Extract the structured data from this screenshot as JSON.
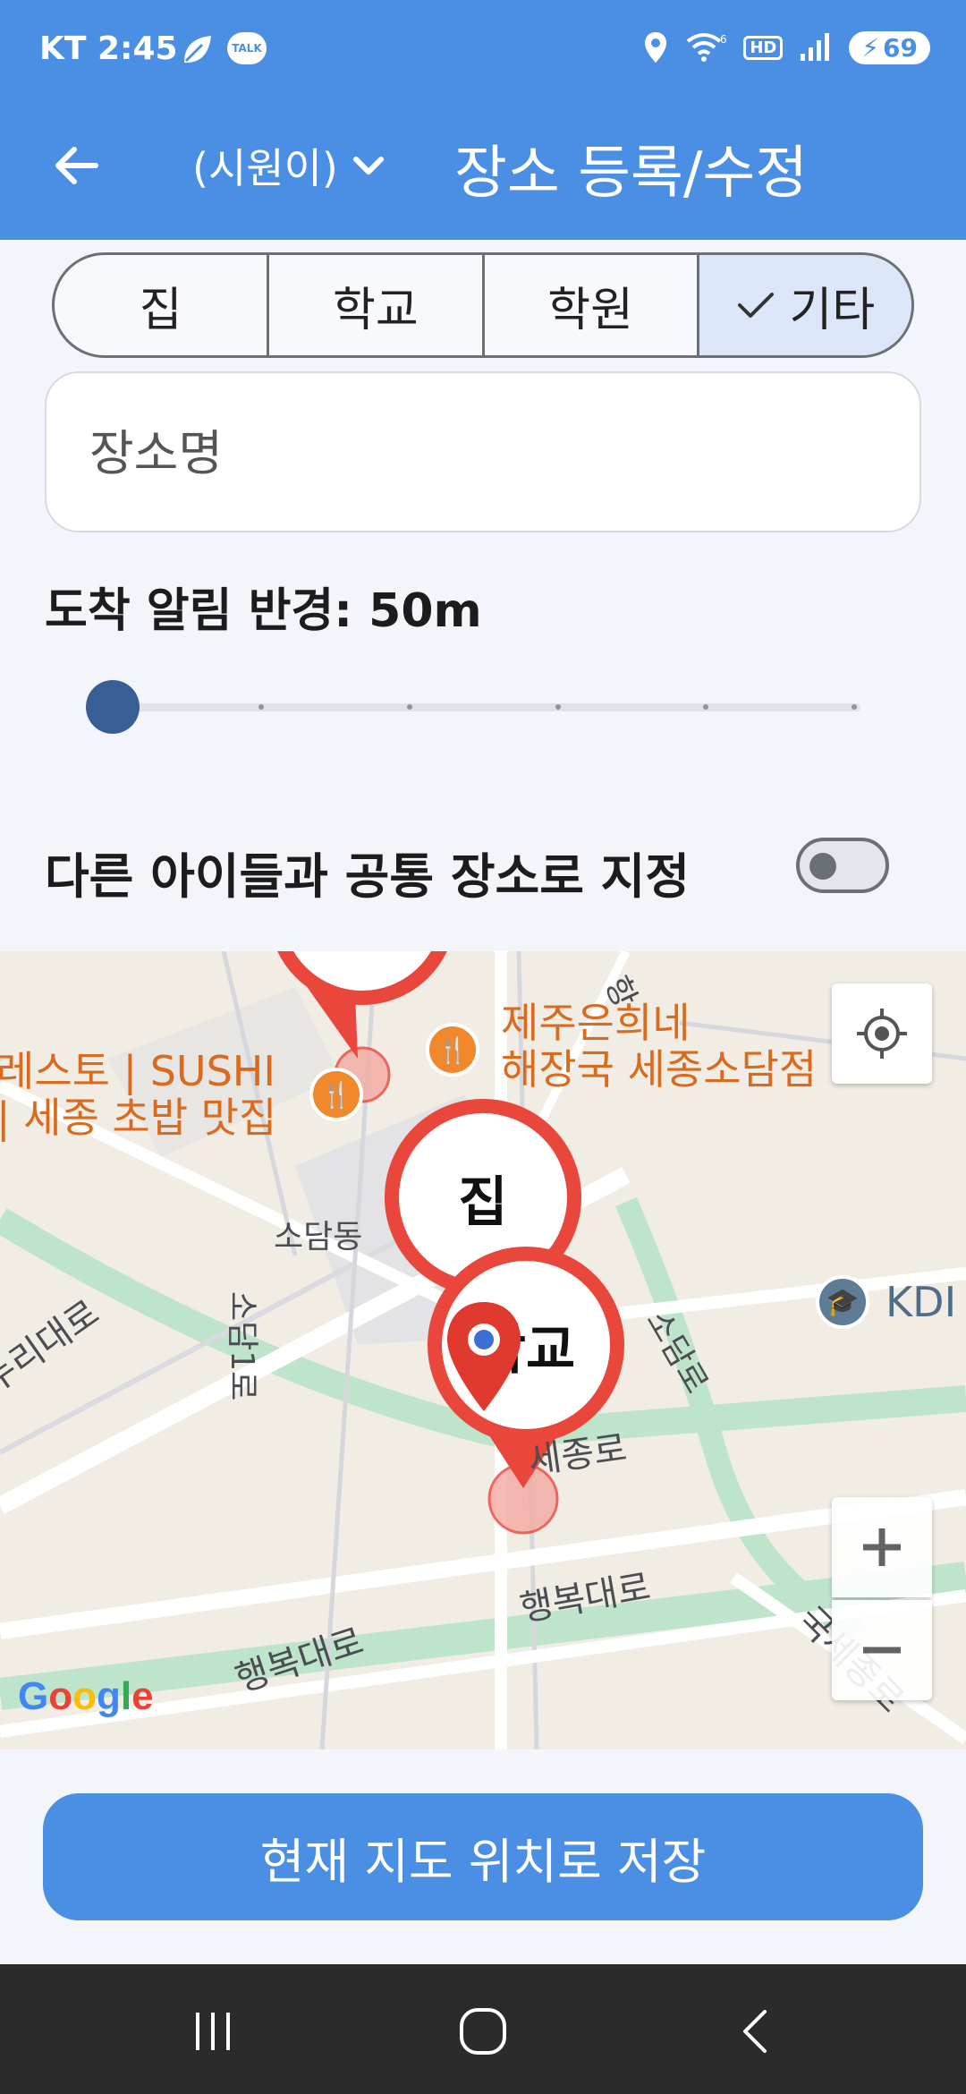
{
  "status_bar": {
    "carrier": "KT",
    "time": "2:45",
    "talk_badge": "TALK",
    "network_badge": "HD",
    "battery_level": "69"
  },
  "app_bar": {
    "child_name": "(시원이)",
    "title": "장소 등록/수정"
  },
  "place_types": {
    "options": [
      "집",
      "학교",
      "학원",
      "기타"
    ],
    "selected_index": 3
  },
  "name_field": {
    "value": "",
    "placeholder": "장소명"
  },
  "radius": {
    "label": "도착 알림 반경: 50m",
    "level_fraction": 0.0
  },
  "shared_place": {
    "label": "다른 아이들과 공통 장소로 지정",
    "enabled": false
  },
  "map": {
    "poi_labels": [
      "제주은희네\n해장국 세종소담점",
      "레스토 | SUSHI\n| 세종 초밥 맛집",
      "KDI"
    ],
    "district_label": "소담동",
    "road_labels": [
      "소담1로",
      "누리대로",
      "소담로",
      "행복대로",
      "행복대로",
      "세종로",
      "국세종로",
      "항"
    ],
    "pins": [
      "집",
      "학교"
    ],
    "attribution": "Google"
  },
  "save_button": {
    "label": "현재 지도 위치로 저장"
  },
  "colors": {
    "primary": "#4a8fe3",
    "pin_red": "#e9463c",
    "poi_orange": "#d96b1e"
  }
}
